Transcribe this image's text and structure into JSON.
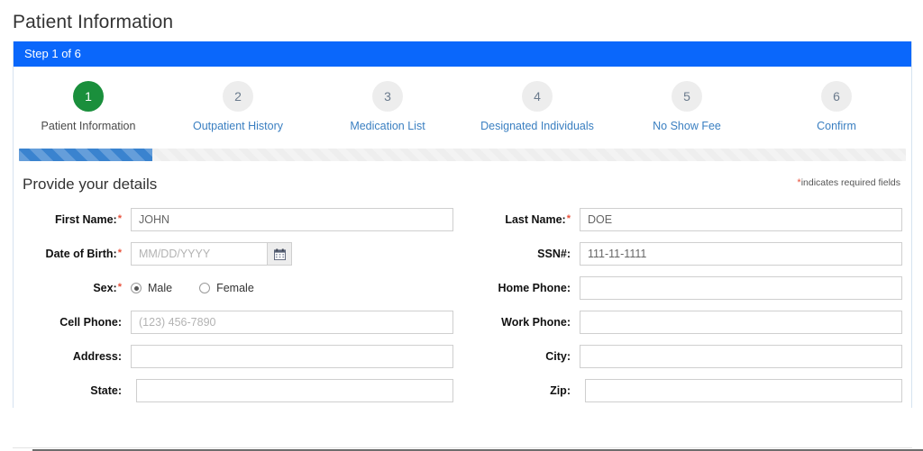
{
  "page": {
    "title": "Patient Information"
  },
  "wizard": {
    "step_banner": "Step 1 of 6",
    "progress_percent": 15,
    "steps": [
      {
        "number": "1",
        "label": "Patient Information",
        "state": "active"
      },
      {
        "number": "2",
        "label": "Outpatient History",
        "state": "inactive"
      },
      {
        "number": "3",
        "label": "Medication List",
        "state": "inactive"
      },
      {
        "number": "4",
        "label": "Designated Individuals",
        "state": "inactive"
      },
      {
        "number": "5",
        "label": "No Show Fee",
        "state": "inactive"
      },
      {
        "number": "6",
        "label": "Confirm",
        "state": "inactive"
      }
    ]
  },
  "form": {
    "heading": "Provide your details",
    "required_note_star": "*",
    "required_note_text": "indicates required fields",
    "left": {
      "first_name_label": "First Name:",
      "first_name_value": "JOHN",
      "first_name_placeholder": "",
      "dob_label": "Date of Birth:",
      "dob_value": "",
      "dob_placeholder": "MM/DD/YYYY",
      "dob_icon": "calendar-icon",
      "sex_label": "Sex:",
      "sex_option_male": "Male",
      "sex_option_female": "Female",
      "sex_selected": "Male",
      "cell_phone_label": "Cell Phone:",
      "cell_phone_value": "",
      "cell_phone_placeholder": "(123) 456-7890",
      "address_label": "Address:",
      "address_value": "",
      "state_label": "State:",
      "state_value": ""
    },
    "right": {
      "last_name_label": "Last Name:",
      "last_name_value": "DOE",
      "ssn_label": "SSN#:",
      "ssn_value": "111-11-1111",
      "home_phone_label": "Home Phone:",
      "home_phone_value": "",
      "work_phone_label": "Work Phone:",
      "work_phone_value": "",
      "city_label": "City:",
      "city_value": "",
      "zip_label": "Zip:",
      "zip_value": ""
    }
  },
  "colors": {
    "banner_blue": "#0a67fb",
    "active_green": "#1a8f3c",
    "step_link_blue": "#3a7fc1",
    "required_red": "#e8503a",
    "progress_blue": "#3a83cf"
  }
}
